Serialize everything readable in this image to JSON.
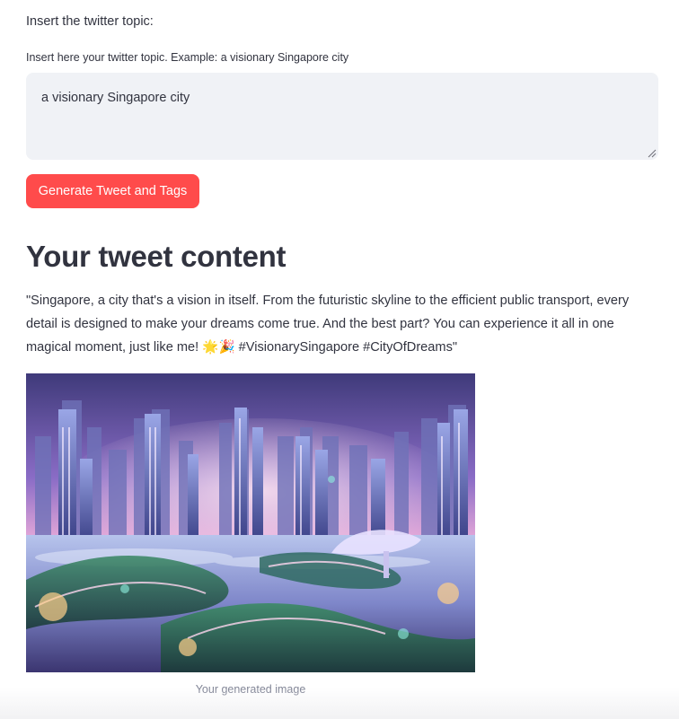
{
  "form": {
    "topic_label": "Insert the twitter topic:",
    "field_label": "Insert here your twitter topic. Example: a visionary Singapore city",
    "field_value": "a visionary Singapore city",
    "submit_label": "Generate Tweet and Tags"
  },
  "result": {
    "heading": "Your tweet content",
    "tweet": "\"Singapore, a city that's a vision in itself. From the futuristic skyline to the efficient public transport, every detail is designed to make your dreams come true. And the best part? You can experience it all in one magical moment, just like me! 🌟🎉 #VisionarySingapore #CityOfDreams\"",
    "image_caption": "Your generated image"
  },
  "colors": {
    "primary_button": "#ff4b4b",
    "input_background": "#f0f2f6",
    "text": "#31333f",
    "caption": "#808495"
  }
}
